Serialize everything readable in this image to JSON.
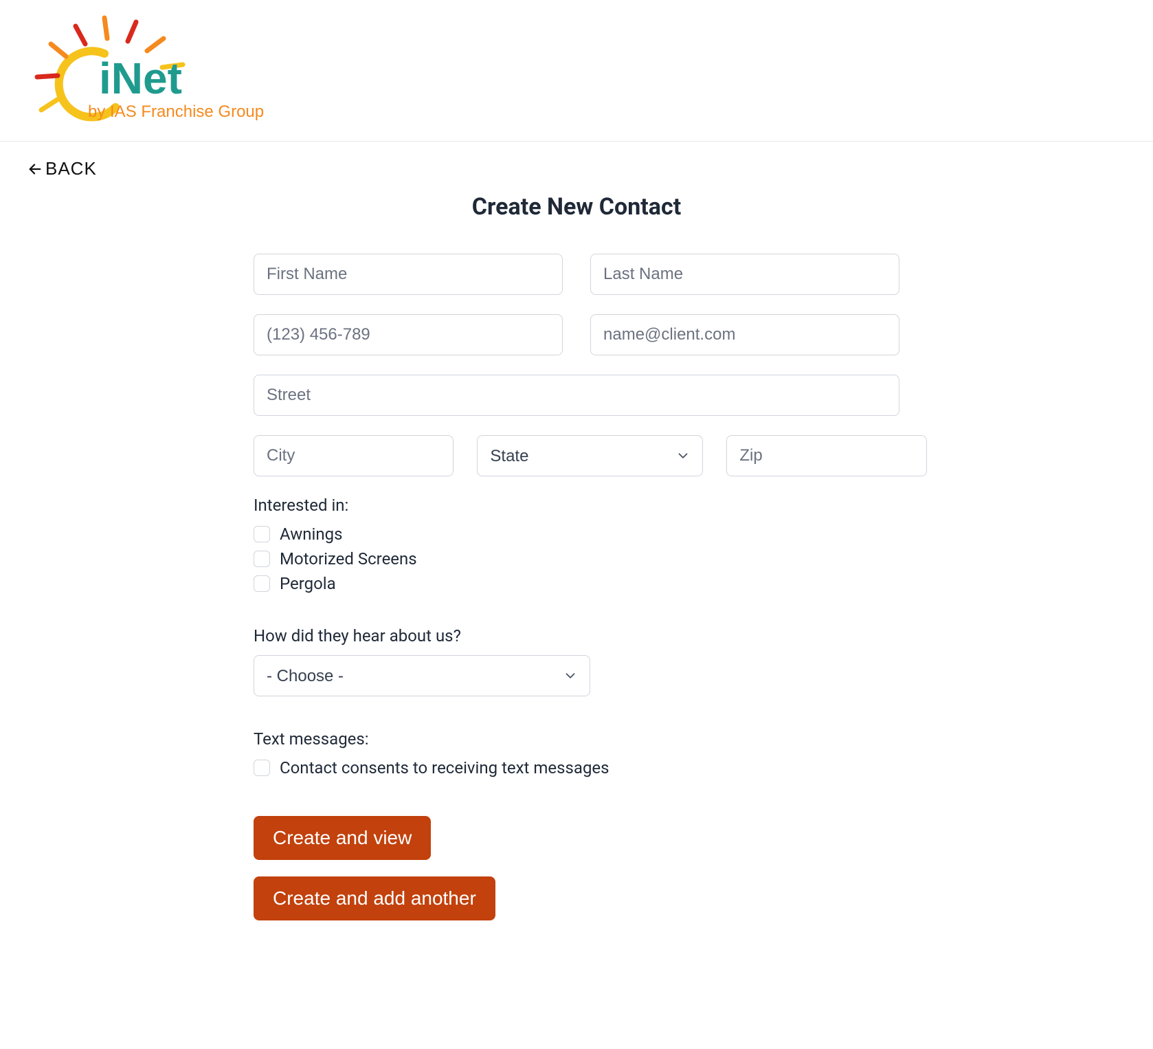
{
  "header": {
    "logo_primary": "iNet",
    "logo_secondary": "by IAS Franchise Group"
  },
  "nav": {
    "back_label": "BACK"
  },
  "page": {
    "title": "Create New Contact"
  },
  "form": {
    "first_name": {
      "value": "",
      "placeholder": "First Name"
    },
    "last_name": {
      "value": "",
      "placeholder": "Last Name"
    },
    "phone": {
      "value": "",
      "placeholder": "(123) 456-789"
    },
    "email": {
      "value": "",
      "placeholder": "name@client.com"
    },
    "street": {
      "value": "",
      "placeholder": "Street"
    },
    "city": {
      "value": "",
      "placeholder": "City"
    },
    "state": {
      "selected": "State"
    },
    "zip": {
      "value": "",
      "placeholder": "Zip"
    },
    "interested_label": "Interested in:",
    "interested_options": [
      {
        "label": "Awnings",
        "checked": false
      },
      {
        "label": "Motorized Screens",
        "checked": false
      },
      {
        "label": "Pergola",
        "checked": false
      }
    ],
    "hear_label": "How did they hear about us?",
    "hear_selected": "- Choose -",
    "text_label": "Text messages:",
    "text_consent": {
      "label": "Contact consents to receiving text messages",
      "checked": false
    },
    "submit_view": "Create and view",
    "submit_another": "Create and add another"
  },
  "colors": {
    "accent": "#c2410c",
    "logo_teal": "#1f9b8e",
    "logo_orange": "#f58a1f",
    "logo_yellow": "#f6c21c"
  }
}
